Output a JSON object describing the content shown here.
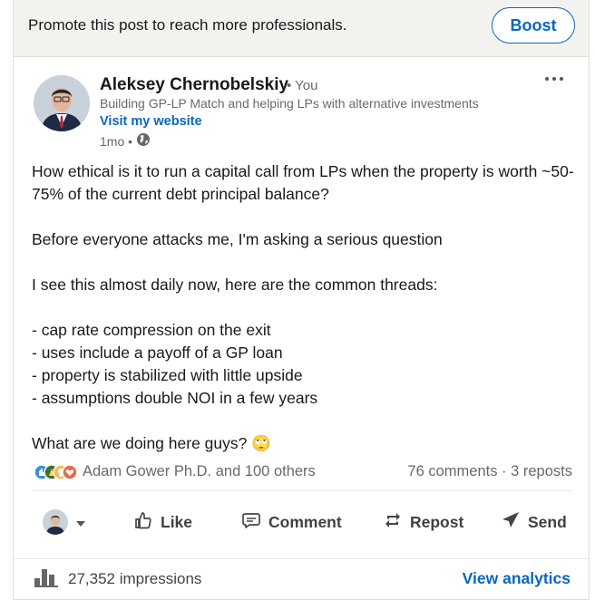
{
  "promo": {
    "text": "Promote this post to reach more professionals.",
    "boost_label": "Boost"
  },
  "author": {
    "name": "Aleksey Chernobelskiy",
    "relation": "• You",
    "headline": "Building GP-LP Match and helping LPs with alternative investments",
    "website_label": "Visit my website",
    "time": "1mo •",
    "visibility_icon": "globe-icon"
  },
  "post": {
    "paragraphs": [
      "How ethical is it to run a capital call from LPs when the property is worth ~50-75% of the current debt principal balance?",
      "",
      "Before everyone attacks me, I'm asking a serious question",
      "",
      "I see this almost daily now, here are the common threads:",
      "",
      "- cap rate compression on the exit",
      "- uses include a payoff of a GP loan",
      "- property is stabilized with little upside",
      "- assumptions double NOI in a few years",
      "",
      "What are we doing here guys? 🙄"
    ]
  },
  "social": {
    "reaction_icons": [
      "like-reaction-icon",
      "celebrate-reaction-icon",
      "insightful-reaction-icon",
      "love-reaction-icon"
    ],
    "reactions_text": "Adam Gower Ph.D. and 100 others",
    "counts_text": "76 comments · 3 reposts"
  },
  "actions": {
    "like": "Like",
    "comment": "Comment",
    "repost": "Repost",
    "send": "Send"
  },
  "footer": {
    "impressions": "27,352 impressions",
    "analytics_label": "View analytics"
  },
  "colors": {
    "accent": "#0a66c2",
    "promo_bg": "#f3f2ef"
  }
}
